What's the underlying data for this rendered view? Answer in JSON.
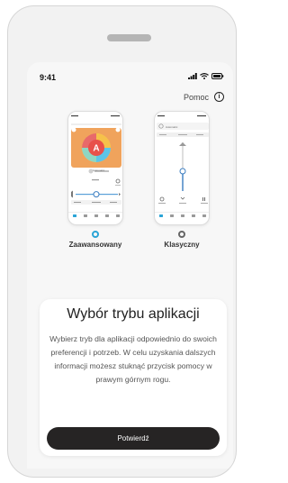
{
  "status_bar": {
    "time": "9:41"
  },
  "help": {
    "label": "Pomoc",
    "icon": "info-icon"
  },
  "modes": [
    {
      "id": "advanced",
      "label": "Zaawansowany",
      "selected": true
    },
    {
      "id": "classic",
      "label": "Klasyczny",
      "selected": false
    }
  ],
  "previews": {
    "advanced": {
      "program": "Automatic"
    },
    "classic": {
      "program": "Automatic"
    }
  },
  "card": {
    "title": "Wybór trybu aplikacji",
    "body": "Wybierz tryb dla aplikacji odpowiednio do swoich preferencji i potrzeb. W celu uzyskania dalszych informacji możesz stuknąć przycisk pomocy w prawym górnym rogu.",
    "confirm_label": "Potwierdź"
  },
  "colors": {
    "accent": "#2aa4d6",
    "button_dark": "#262424",
    "background": "#f7f7f7"
  }
}
